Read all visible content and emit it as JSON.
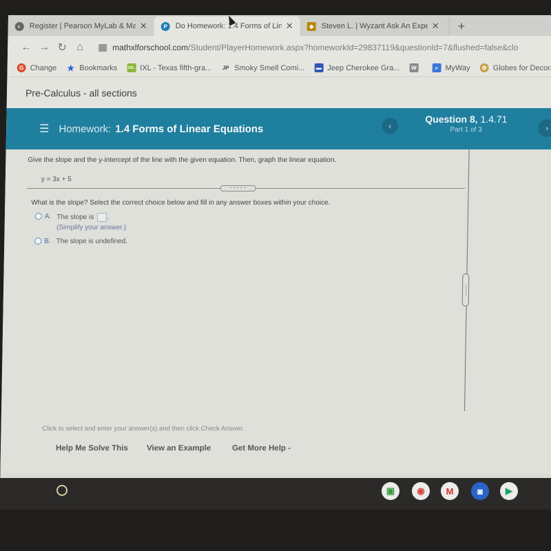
{
  "browser": {
    "tabs": [
      {
        "title": "Register | Pearson MyLab & Mat",
        "icon": "globe-icon",
        "active": false
      },
      {
        "title": "Do Homework: 1.4 Forms of Lin",
        "icon": "pearson-icon",
        "active": true
      },
      {
        "title": "Steven L. | Wyzant Ask An Expert",
        "icon": "wyzant-icon",
        "active": false
      }
    ],
    "close_glyph": "✕",
    "new_tab_glyph": "+",
    "nav": {
      "back": "←",
      "forward": "→",
      "reload": "↻",
      "home": "⌂"
    },
    "url_host": "mathxlforschool.com",
    "url_path": "/Student/PlayerHomework.aspx?homeworkId=29837119&questionId=7&flushed=false&clo",
    "bookmarks": [
      {
        "label": "Change",
        "icon": "google-plus-icon",
        "color": "#d9502f",
        "glyph": "G"
      },
      {
        "label": "Bookmarks",
        "icon": "star-icon",
        "color": "#2b5fd6",
        "glyph": "★"
      },
      {
        "label": "IXL - Texas fifth-gra...",
        "icon": "ixl-icon",
        "color": "#8bb83a",
        "glyph": "IXL"
      },
      {
        "label": "Smoky Smell Comi...",
        "icon": "jp-icon",
        "color": "#444444",
        "glyph": "JP"
      },
      {
        "label": "Jeep Cherokee Gra...",
        "icon": "car-icon",
        "color": "#2f55b8",
        "glyph": "🚙"
      },
      {
        "label": "",
        "icon": "w-icon",
        "color": "#8a8a8a",
        "glyph": "W"
      },
      {
        "label": "MyWay",
        "icon": "search-icon",
        "color": "#3a78d4",
        "glyph": "🔍"
      },
      {
        "label": "Globes for Decora",
        "icon": "globe-decor-icon",
        "color": "#c9a24a",
        "glyph": "✿"
      }
    ]
  },
  "page": {
    "course": "Pre-Calculus - all sections",
    "homework_label": "Homework:",
    "homework_title": "1.4 Forms of Linear Equations",
    "question_label": "Question 8,",
    "question_ref": "1.4.71",
    "part": "Part 1 of 3",
    "prev_glyph": "‹",
    "next_glyph": "›",
    "instruction": "Give the slope and the y-intercept of the line with the given equation.  Then, graph the linear equation.",
    "equation": "y = 3x + 5",
    "grip_dots": "• • • • •",
    "question": "What is the slope? Select the correct choice below and fill in any answer boxes within your choice.",
    "choices": [
      {
        "letter": "A.",
        "text": "The slope is",
        "suffix": ".",
        "hint": "(Simplify your answer.)",
        "answer": ""
      },
      {
        "letter": "B.",
        "text": "The slope is undefined."
      }
    ],
    "footer_hint": "Click to select and enter your answer(s) and then click Check Answer.",
    "help_buttons": [
      "Help Me Solve This",
      "View an Example",
      "Get More Help -"
    ]
  },
  "shelf": {
    "launcher_icon": "launcher-icon",
    "apps": [
      {
        "name": "classroom-icon",
        "glyph": "▣",
        "color": "#3a9a3f"
      },
      {
        "name": "chrome-icon",
        "glyph": "◉",
        "color": "#d9443b"
      },
      {
        "name": "gmail-icon",
        "glyph": "M",
        "color": "#d93025"
      },
      {
        "name": "camera-icon",
        "glyph": "◙",
        "color": "#2b63c9"
      },
      {
        "name": "play-store-icon",
        "glyph": "▶",
        "color": "#1ea362"
      }
    ]
  }
}
